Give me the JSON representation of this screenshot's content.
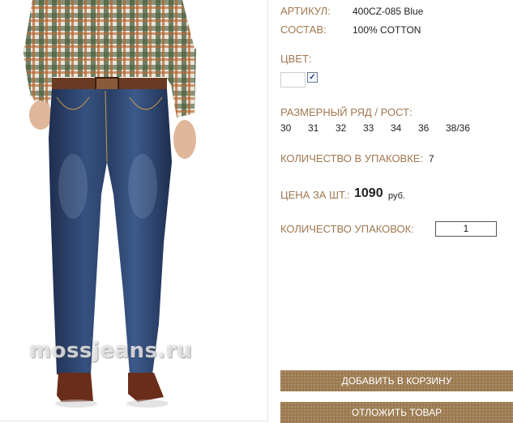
{
  "product": {
    "article_label": "АРТИКУЛ:",
    "article_value": "400CZ-085 Blue",
    "composition_label": "СОСТАВ:",
    "composition_value": "100% COTTON",
    "color_label": "ЦВЕТ:",
    "color_checkbox": "✓",
    "sizes_label": "РАЗМЕРНЫЙ РЯД / РОСТ:",
    "sizes": [
      "30",
      "31",
      "32",
      "33",
      "34",
      "36",
      "38/36"
    ],
    "pack_qty_label": "КОЛИЧЕСТВО В УПАКОВКЕ:",
    "pack_qty_value": "7",
    "price_label": "ЦЕНА ЗА ШТ.:",
    "price_value": "1090",
    "price_currency": "руб.",
    "packs_label": "КОЛИЧЕСТВО УПАКОВОК:",
    "packs_value": "1"
  },
  "actions": {
    "add_to_cart": "ДОБАВИТЬ В КОРЗИНУ",
    "save_item": "ОТЛОЖИТЬ ТОВАР"
  },
  "watermark": "mossjeans.ru",
  "colors": {
    "label": "#a07850",
    "button": "#9c7a50",
    "denim": "#2a3d63"
  }
}
